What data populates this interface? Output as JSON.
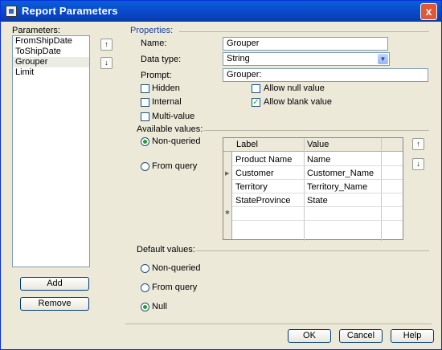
{
  "window": {
    "title": "Report Parameters",
    "close_glyph": "x"
  },
  "parameters": {
    "label": "Parameters:",
    "items": [
      "FromShipDate",
      "ToShipDate",
      "Grouper",
      "Limit"
    ],
    "selected_index": 2,
    "move_up_glyph": "↑",
    "move_down_glyph": "↓",
    "add_label": "Add",
    "remove_label": "Remove"
  },
  "properties": {
    "label": "Properties:",
    "name_label": "Name:",
    "name_value": "Grouper",
    "datatype_label": "Data type:",
    "datatype_value": "String",
    "prompt_label": "Prompt:",
    "prompt_value": "Grouper:",
    "hidden_label": "Hidden",
    "hidden_checked": false,
    "internal_label": "Internal",
    "internal_checked": false,
    "multivalue_label": "Multi-value",
    "multivalue_checked": false,
    "allow_null_label": "Allow null value",
    "allow_null_checked": false,
    "allow_blank_label": "Allow blank value",
    "allow_blank_checked": true,
    "check_glyph": "✓"
  },
  "available_values": {
    "label": "Available values:",
    "non_queried_label": "Non-queried",
    "from_query_label": "From query",
    "selected": "Non-queried",
    "grid": {
      "headers": [
        "Label",
        "Value"
      ],
      "rows": [
        [
          "Product Name",
          "Name"
        ],
        [
          "Customer",
          "Customer_Name"
        ],
        [
          "Territory",
          "Territory_Name"
        ],
        [
          "StateProvince",
          "State"
        ]
      ],
      "current_row_marker": "▶",
      "new_row_marker": "✱"
    },
    "move_up_glyph": "↑",
    "move_down_glyph": "↓"
  },
  "default_values": {
    "label": "Default values:",
    "non_queried_label": "Non-queried",
    "from_query_label": "From query",
    "null_label": "Null",
    "selected": "Null"
  },
  "footer": {
    "ok_label": "OK",
    "cancel_label": "Cancel",
    "help_label": "Help"
  },
  "colors": {
    "title_bar": "#0a46c8",
    "accent_text": "#1c3f9c",
    "dialog_bg": "#ece9d8"
  }
}
